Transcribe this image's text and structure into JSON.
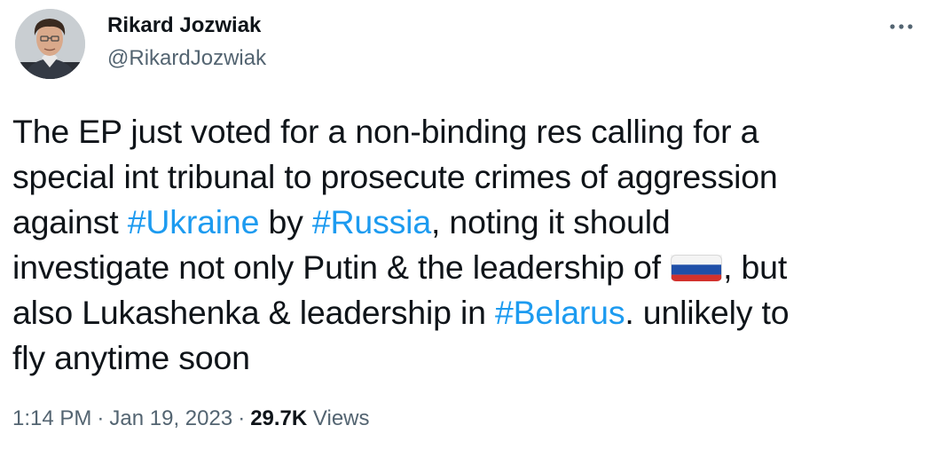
{
  "author": {
    "name": "Rikard Jozwiak",
    "handle": "@RikardJozwiak"
  },
  "menu": {
    "icon": "more-horizontal-icon"
  },
  "tweet": {
    "lines": [
      [
        {
          "t": "The EP just voted for a non-binding res calling for a"
        }
      ],
      [
        {
          "t": "special int tribunal to prosecute crimes of aggression"
        }
      ],
      [
        {
          "t": "against "
        },
        {
          "t": "#Ukraine",
          "hashtag": true
        },
        {
          "t": " by "
        },
        {
          "t": "#Russia",
          "hashtag": true
        },
        {
          "t": ", noting it should"
        }
      ],
      [
        {
          "t": "investigate not only Putin & the leadership of "
        },
        {
          "flag": "russia-flag-icon"
        },
        {
          "t": ", but"
        }
      ],
      [
        {
          "t": "also Lukashenka & leadership in "
        },
        {
          "t": "#Belarus",
          "hashtag": true
        },
        {
          "t": ". unlikely to"
        }
      ],
      [
        {
          "t": "fly anytime soon"
        }
      ]
    ]
  },
  "meta": {
    "time": "1:14 PM",
    "separator": "·",
    "date": "Jan 19, 2023",
    "views_count": "29.7K",
    "views_label": "Views"
  },
  "colors": {
    "text": "#0f1419",
    "secondary": "#536471",
    "link": "#1d9bf0"
  }
}
